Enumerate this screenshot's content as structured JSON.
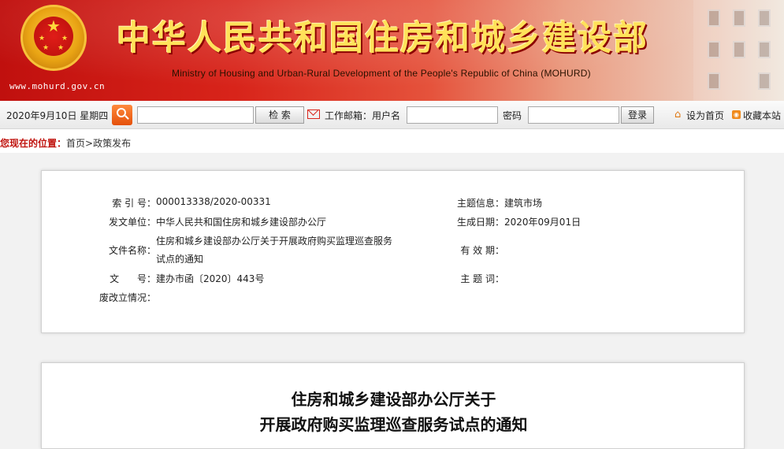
{
  "header": {
    "site_url": "www.mohurd.gov.cn",
    "title_cn": "中华人民共和国住房和城乡建设部",
    "title_en": "Ministry of Housing and Urban-Rural Development of the People's Republic of China (MOHURD)"
  },
  "toolbar": {
    "date": "2020年9月10日 星期四",
    "search_value": "",
    "search_button": "检  索",
    "mail_label": "工作邮箱：用户名",
    "username_value": "",
    "password_label": "密码",
    "password_value": "",
    "login_button": "登录",
    "set_home": "设为首页",
    "bookmark": "收藏本站"
  },
  "breadcrumb": {
    "label": "您现在的位置：",
    "home": "首页",
    "separator": ">",
    "current": "政策发布"
  },
  "info": {
    "index_label": "索 引 号：",
    "index_value": "000013338/2020-00331",
    "topic_label": "主题信息：",
    "topic_value": "建筑市场",
    "issuer_label": "发文单位：",
    "issuer_value": "中华人民共和国住房和城乡建设部办公厅",
    "date_label": "生成日期：",
    "date_value": "2020年09月01日",
    "docname_label": "文件名称：",
    "docname_line1": "住房和城乡建设部办公厅关于开展政府购买监理巡查服务",
    "docname_line2": "试点的通知",
    "validity_label": "有 效 期：",
    "validity_value": "",
    "docno_label": "文      号：",
    "docno_value": "建办市函〔2020〕443号",
    "keyword_label": "主 题 词：",
    "keyword_value": "",
    "status_label": "废改立情况：",
    "status_value": ""
  },
  "article": {
    "title_line1": "住房和城乡建设部办公厅关于",
    "title_line2": "开展政府购买监理巡查服务试点的通知"
  },
  "colors": {
    "brand_red": "#c0140f",
    "title_gold": "#ffe25a"
  }
}
